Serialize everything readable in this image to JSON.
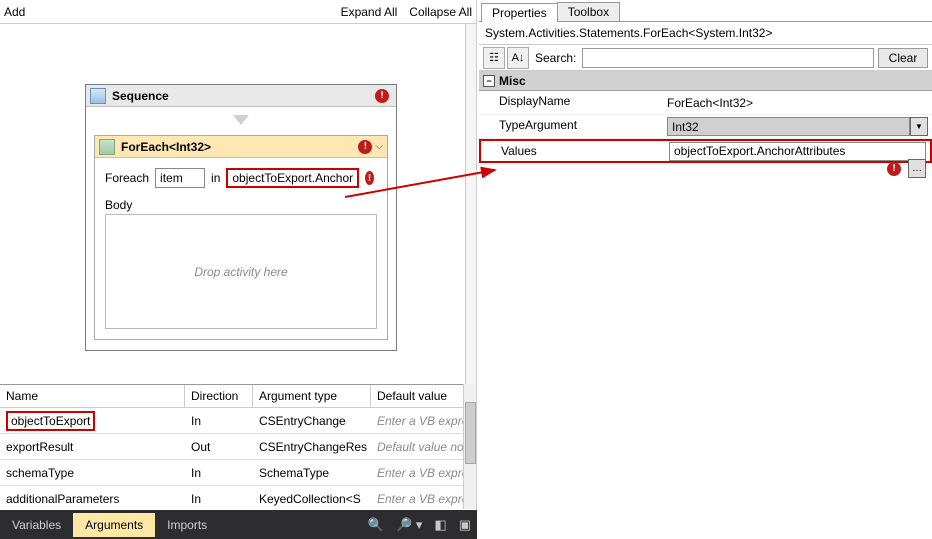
{
  "toolbar": {
    "add": "Add",
    "expand": "Expand All",
    "collapse": "Collapse All"
  },
  "sequence": {
    "title": "Sequence"
  },
  "foreach": {
    "title": "ForEach<Int32>",
    "label_foreach": "Foreach",
    "item_text": "item",
    "label_in": "in",
    "expr": "objectToExport.Anchor",
    "body_label": "Body",
    "drop_hint": "Drop activity here"
  },
  "args": {
    "headers": {
      "name": "Name",
      "direction": "Direction",
      "type": "Argument type",
      "def": "Default value"
    },
    "rows": [
      {
        "name": "objectToExport",
        "dir": "In",
        "type": "CSEntryChange",
        "def": "Enter a VB express",
        "ph": true,
        "red": true
      },
      {
        "name": "exportResult",
        "dir": "Out",
        "type": "CSEntryChangeRes",
        "def": "Default value not su",
        "ph": true
      },
      {
        "name": "schemaType",
        "dir": "In",
        "type": "SchemaType",
        "def": "Enter a VB express",
        "ph": true
      },
      {
        "name": "additionalParameters",
        "dir": "In",
        "type": "KeyedCollection<S",
        "def": "Enter a VB express",
        "ph": true
      }
    ]
  },
  "bottom": {
    "variables": "Variables",
    "arguments": "Arguments",
    "imports": "Imports"
  },
  "right": {
    "tab_props": "Properties",
    "tab_toolbox": "Toolbox",
    "type_line": "System.Activities.Statements.ForEach<System.Int32>",
    "search_label": "Search:",
    "clear": "Clear",
    "misc": "Misc",
    "rows": {
      "display": {
        "name": "DisplayName",
        "val": "ForEach<Int32>"
      },
      "typearg": {
        "name": "TypeArgument",
        "val": "Int32"
      },
      "values": {
        "name": "Values",
        "val": "objectToExport.AnchorAttributes"
      }
    }
  }
}
